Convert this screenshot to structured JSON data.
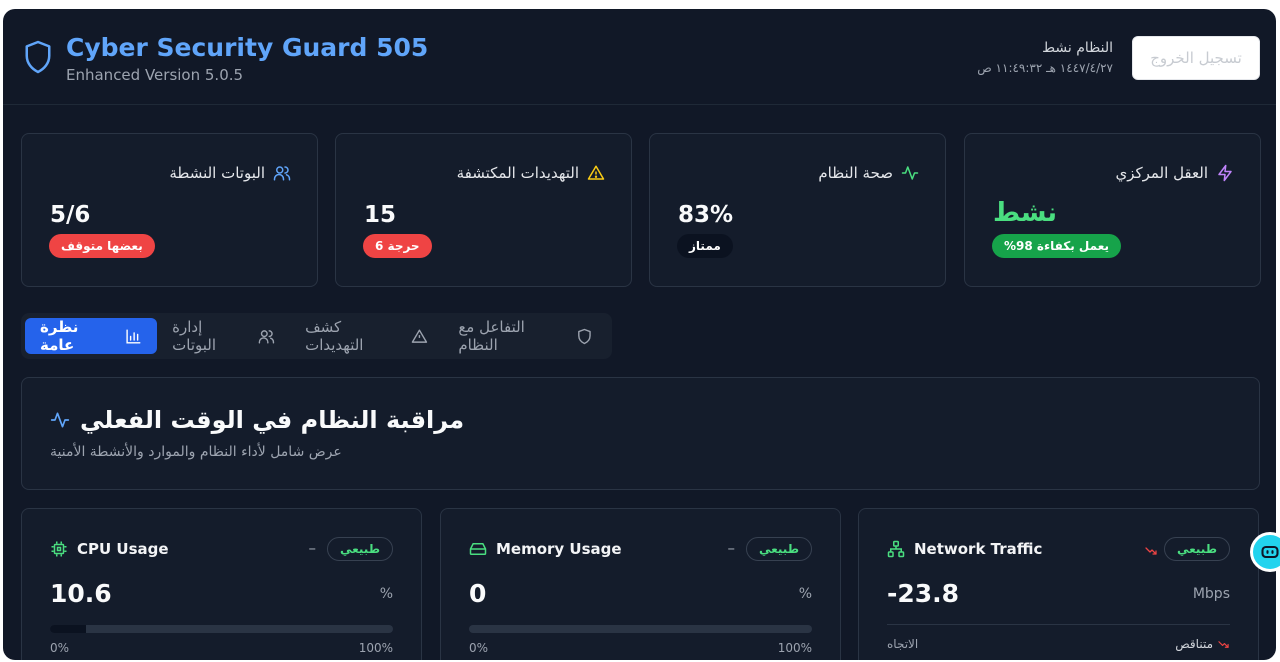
{
  "header": {
    "title": "Cyber Security Guard 505",
    "subtitle": "Enhanced Version 5.0.5",
    "system_status": "النظام نشط",
    "datetime": "١٤٤٧/٤/٢٧ هـ ١١:٤٩:٣٢ ص",
    "logout_label": "تسجيل الخروج"
  },
  "cards": [
    {
      "title": "البوتات النشطة",
      "icon": "users-icon",
      "value": "5/6",
      "badge": "بعضها متوقف",
      "badge_color": "#ef4444"
    },
    {
      "title": "التهديدات المكتشفة",
      "icon": "alert-triangle-icon",
      "value": "15",
      "badge": "حرجة 6",
      "badge_color": "#ef4444"
    },
    {
      "title": "صحة النظام",
      "icon": "activity-icon",
      "value": "83%",
      "badge": "ممتاز",
      "badge_color": "#0b1220"
    },
    {
      "title": "العقل المركزي",
      "icon": "zap-icon",
      "value": "نشط",
      "badge": "%يعمل بكفاءة 98",
      "badge_color": "#16a34a"
    }
  ],
  "tabs": [
    {
      "label": "نظرة عامة",
      "icon": "bar-chart-icon",
      "active": true
    },
    {
      "label": "إدارة البوتات",
      "icon": "users-icon",
      "active": false
    },
    {
      "label": "كشف التهديدات",
      "icon": "alert-triangle-icon",
      "active": false
    },
    {
      "label": "التفاعل مع النظام",
      "icon": "shield-icon",
      "active": false
    }
  ],
  "monitor": {
    "title": "مراقبة النظام في الوقت الفعلي",
    "subtitle": "عرض شامل لأداء النظام والموارد والأنشطة الأمنية"
  },
  "metrics": {
    "cpu": {
      "title": "CPU Usage",
      "badge": "طبيعي",
      "trend": "–",
      "value": "10.6",
      "unit": "%",
      "progress_percent": 10.6,
      "min_label": "0%",
      "max_label": "100%"
    },
    "memory": {
      "title": "Memory Usage",
      "badge": "طبيعي",
      "trend": "–",
      "value": "0",
      "unit": "%",
      "progress_percent": 0,
      "min_label": "0%",
      "max_label": "100%"
    },
    "network": {
      "title": "Network Traffic",
      "badge": "طبيعي",
      "value": "-23.8",
      "unit": "Mbps",
      "direction_label": "الاتجاه",
      "direction_value": "متناقص"
    }
  }
}
